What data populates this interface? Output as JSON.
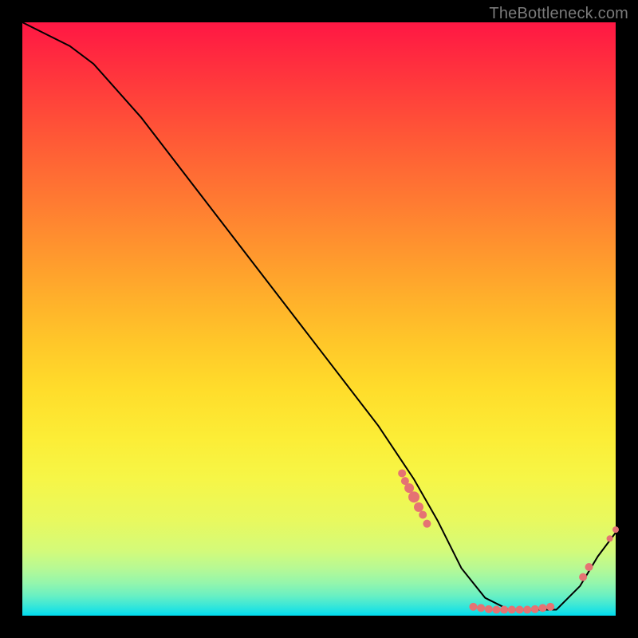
{
  "watermark": "TheBottleneck.com",
  "colors": {
    "point": "#e57373",
    "curve": "#000000",
    "frame": "#000000"
  },
  "chart_data": {
    "type": "line",
    "title": "",
    "xlabel": "",
    "ylabel": "",
    "xlim": [
      0,
      100
    ],
    "ylim": [
      0,
      100
    ],
    "grid": false,
    "series": [
      {
        "name": "bottleneck-curve",
        "x": [
          0,
          4,
          8,
          12,
          20,
          30,
          40,
          50,
          60,
          66,
          70,
          74,
          78,
          82,
          86,
          90,
          94,
          97,
          100
        ],
        "y": [
          100,
          98,
          96,
          93,
          84,
          71,
          58,
          45,
          32,
          23,
          16,
          8,
          3,
          1,
          1,
          1,
          5,
          10,
          14
        ]
      }
    ],
    "scatter_points": [
      {
        "x": 64.0,
        "y": 24.0,
        "r": 5
      },
      {
        "x": 64.5,
        "y": 22.7,
        "r": 5
      },
      {
        "x": 65.2,
        "y": 21.5,
        "r": 6
      },
      {
        "x": 66.0,
        "y": 20.0,
        "r": 7
      },
      {
        "x": 66.8,
        "y": 18.3,
        "r": 6
      },
      {
        "x": 67.5,
        "y": 17.0,
        "r": 5
      },
      {
        "x": 68.2,
        "y": 15.5,
        "r": 5
      },
      {
        "x": 76.0,
        "y": 1.5,
        "r": 5
      },
      {
        "x": 77.3,
        "y": 1.3,
        "r": 5
      },
      {
        "x": 78.6,
        "y": 1.1,
        "r": 5
      },
      {
        "x": 79.9,
        "y": 1.0,
        "r": 5
      },
      {
        "x": 81.2,
        "y": 1.0,
        "r": 5
      },
      {
        "x": 82.5,
        "y": 1.0,
        "r": 5
      },
      {
        "x": 83.8,
        "y": 1.0,
        "r": 5
      },
      {
        "x": 85.1,
        "y": 1.0,
        "r": 5
      },
      {
        "x": 86.4,
        "y": 1.1,
        "r": 5
      },
      {
        "x": 87.7,
        "y": 1.3,
        "r": 5
      },
      {
        "x": 89.0,
        "y": 1.5,
        "r": 5
      },
      {
        "x": 94.5,
        "y": 6.5,
        "r": 5
      },
      {
        "x": 95.5,
        "y": 8.2,
        "r": 5
      },
      {
        "x": 99.0,
        "y": 13.0,
        "r": 4
      },
      {
        "x": 100.0,
        "y": 14.5,
        "r": 4
      }
    ]
  }
}
